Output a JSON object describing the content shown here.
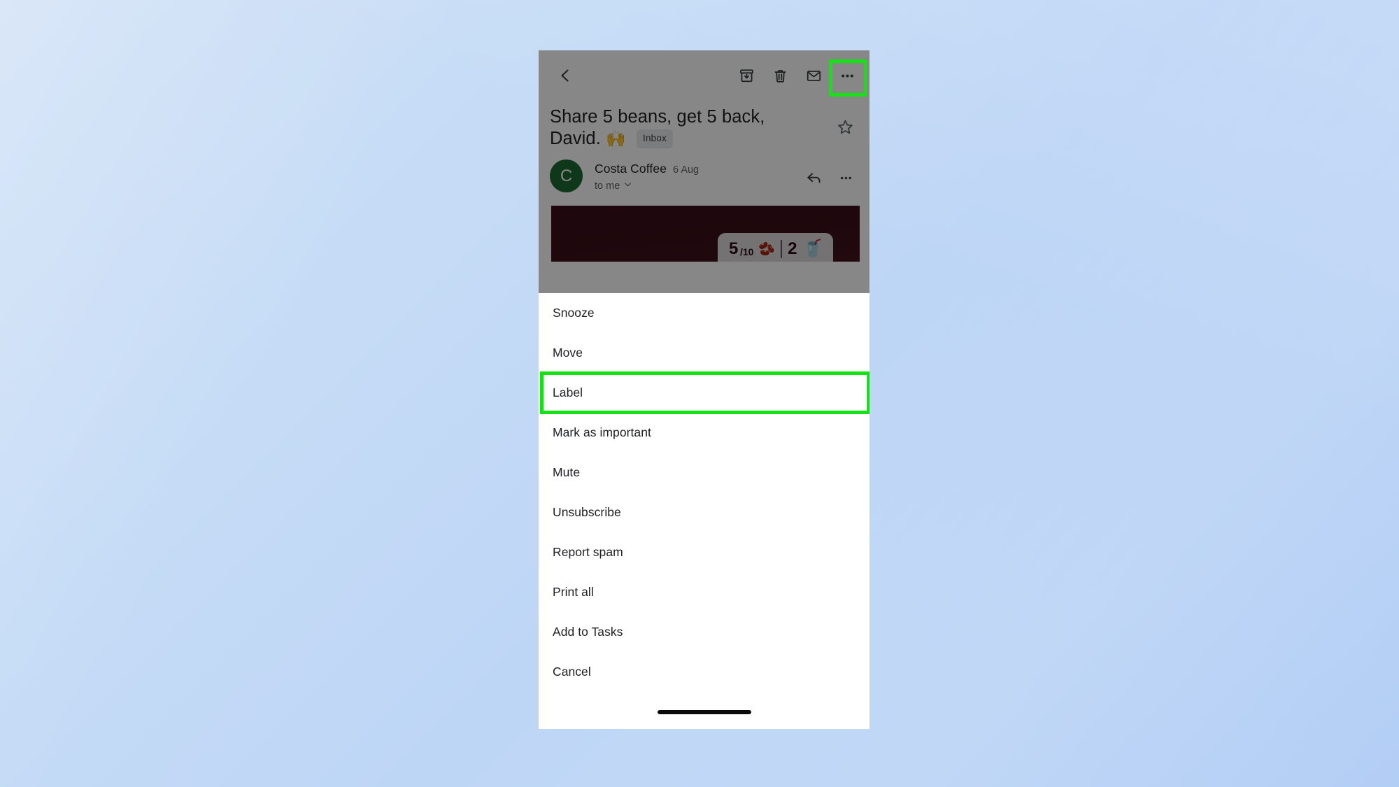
{
  "background": {
    "color_start": "#cfe0f6",
    "color_end": "#b8d2f7"
  },
  "highlight_color": "#15e215",
  "toolbar": {
    "back_label": "Back",
    "archive_label": "Archive",
    "delete_label": "Delete",
    "mark_unread_label": "Mark as unread",
    "more_options_label": "More options"
  },
  "email": {
    "subject_line1": "Share 5 beans, get 5 back,",
    "subject_line2": "David.",
    "subject_emoji": "🙌",
    "label_chip": "Inbox",
    "star_label": "Star",
    "sender_initial": "C",
    "sender_name": "Costa Coffee",
    "date": "6 Aug",
    "recipient": "to me",
    "reply_label": "Reply",
    "message_more_label": "More",
    "banner": {
      "count": "5",
      "denominator": "/10",
      "bean_icon": "🫘",
      "reward": "2",
      "cup_icon": "🥤",
      "background_color": "#3a1018"
    }
  },
  "menu": {
    "items": [
      {
        "label": "Snooze",
        "highlighted": false
      },
      {
        "label": "Move",
        "highlighted": false
      },
      {
        "label": "Label",
        "highlighted": true
      },
      {
        "label": "Mark as important",
        "highlighted": false
      },
      {
        "label": "Mute",
        "highlighted": false
      },
      {
        "label": "Unsubscribe",
        "highlighted": false
      },
      {
        "label": "Report spam",
        "highlighted": false
      },
      {
        "label": "Print all",
        "highlighted": false
      },
      {
        "label": "Add to Tasks",
        "highlighted": false
      },
      {
        "label": "Cancel",
        "highlighted": false
      }
    ]
  }
}
